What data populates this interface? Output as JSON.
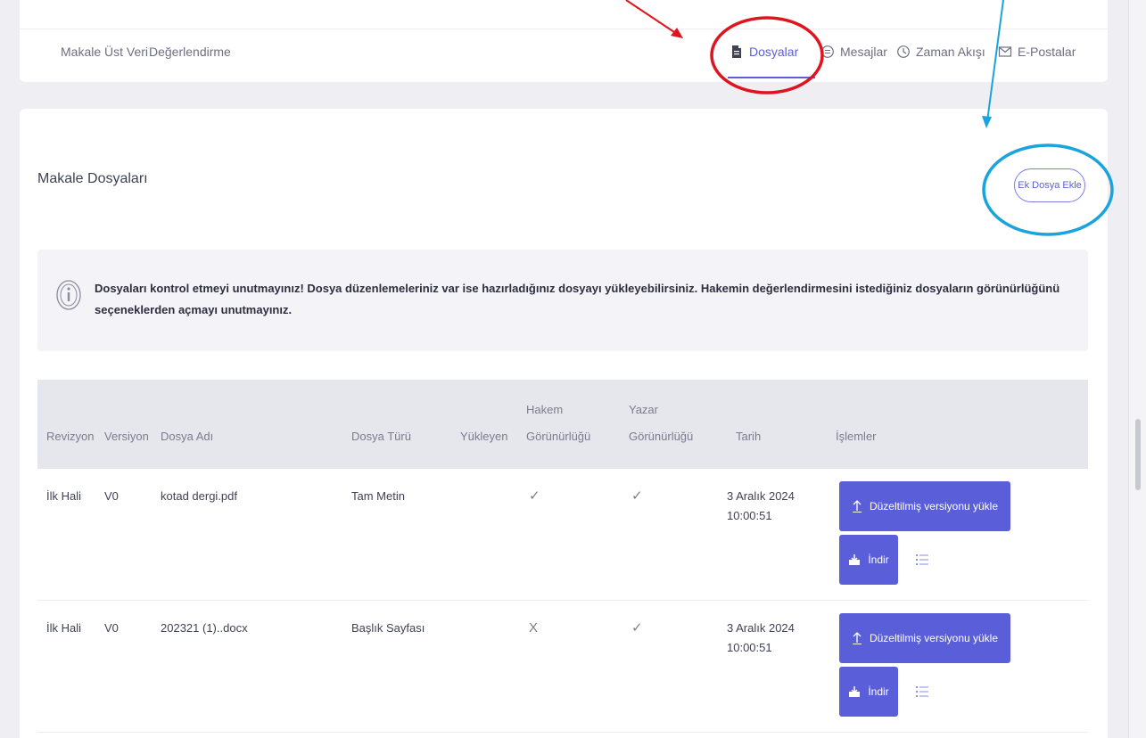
{
  "tabs": {
    "left": [
      {
        "label": "Makale Üst Veri"
      },
      {
        "label": "Değerlendirme"
      }
    ],
    "right": [
      {
        "label": "Dosyalar",
        "icon": "file-icon",
        "active": true
      },
      {
        "label": "Mesajlar",
        "icon": "message-icon"
      },
      {
        "label": "Zaman Akışı",
        "icon": "timeline-icon"
      },
      {
        "label": "E-Postalar",
        "icon": "mail-icon"
      }
    ]
  },
  "section": {
    "title": "Makale Dosyaları",
    "add_button": "Ek Dosya Ekle"
  },
  "alert": {
    "icon": "info-icon",
    "text": "Dosyaları kontrol etmeyi unutmayınız! Dosya düzenlemeleriniz var ise hazırladığınız dosyayı yükleyebilirsiniz. Hakemin değerlendirmesini istediğiniz dosyaların görünürlüğünü seçeneklerden açmayı unutmayınız."
  },
  "table": {
    "headers": {
      "revizyon": "Revizyon",
      "versiyon": "Versiyon",
      "dosya_adi": "Dosya Adı",
      "dosya_turu": "Dosya Türü",
      "yukleyen": "Yükleyen",
      "hakem_1": "Hakem",
      "hakem_2": "Görünürlüğü",
      "yazar_1": "Yazar",
      "yazar_2": "Görünürlüğü",
      "tarih": "Tarih",
      "islemler": "İşlemler"
    },
    "rows": [
      {
        "revizyon": "İlk Hali",
        "versiyon": "V0",
        "dosya_adi": "kotad dergi.pdf",
        "dosya_turu": "Tam Metin",
        "hakem": "✓",
        "yazar": "✓",
        "tarih_1": "3 Aralık 2024",
        "tarih_2": "10:00:51",
        "upload_label": "Düzeltilmiş versiyonu yükle",
        "download_label": "İndir"
      },
      {
        "revizyon": "İlk Hali",
        "versiyon": "V0",
        "dosya_adi": "202321 (1)..docx",
        "dosya_turu": "Başlık Sayfası",
        "hakem": "X",
        "yazar": "✓",
        "tarih_1": "3 Aralık 2024",
        "tarih_2": "10:00:51",
        "upload_label": "Düzeltilmiş versiyonu yükle",
        "download_label": "İndir"
      }
    ]
  },
  "colors": {
    "accent": "#5a5fd9",
    "annotation_red": "#e0141e",
    "annotation_blue": "#1aa3dc"
  }
}
